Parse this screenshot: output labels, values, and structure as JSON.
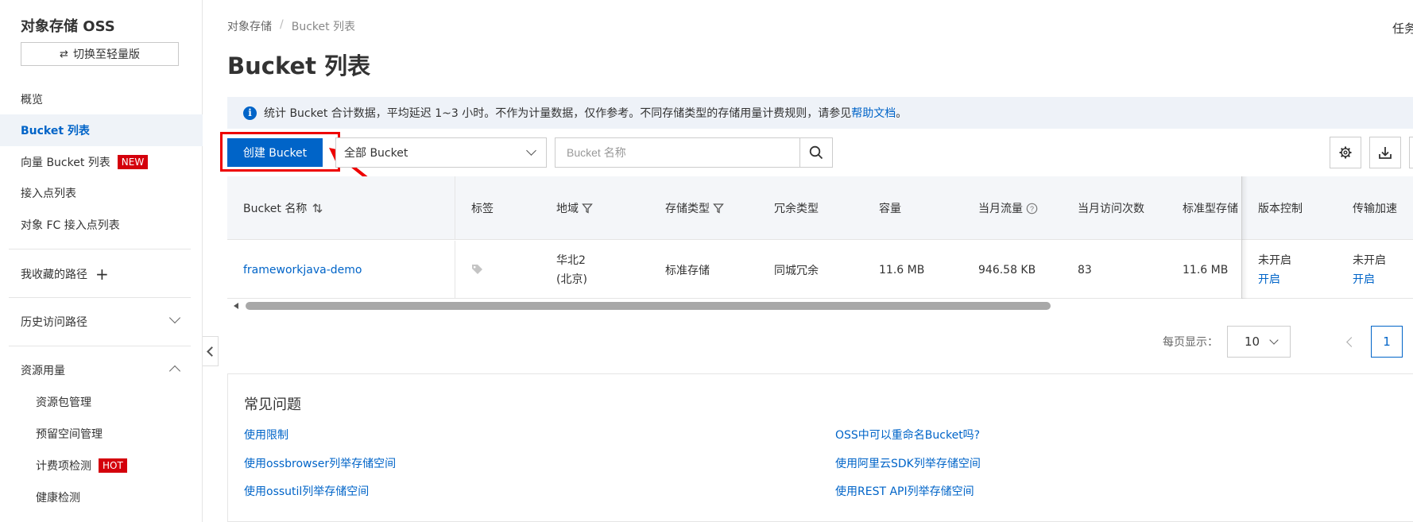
{
  "sidebar": {
    "title": "对象存储 OSS",
    "switch_label": "切换至轻量版",
    "items": [
      {
        "label": "概览"
      },
      {
        "label": "Bucket 列表"
      },
      {
        "label": "向量 Bucket 列表",
        "badge": "NEW"
      },
      {
        "label": "接入点列表"
      },
      {
        "label": "对象 FC 接入点列表"
      },
      {
        "label": "我收藏的路径"
      },
      {
        "label": "历史访问路径"
      },
      {
        "label": "资源用量"
      },
      {
        "label": "资源包管理"
      },
      {
        "label": "预留空间管理"
      },
      {
        "label": "计费项检测",
        "badge": "HOT"
      },
      {
        "label": "健康检测"
      }
    ]
  },
  "breadcrumb": {
    "root": "对象存储",
    "sep": "/",
    "current": "Bucket 列表"
  },
  "page_title": "Bucket 列表",
  "top_right_text": "任务",
  "notice": {
    "text": "统计 Bucket 合计数据，平均延迟 1~3 小时。不作为计量数据，仅作参考。不同存储类型的存储用量计费规则，请参见",
    "link": "帮助文档",
    "end": "。"
  },
  "toolbar": {
    "create_label": "创建 Bucket",
    "filter_value": "全部 Bucket",
    "search_placeholder": "Bucket 名称"
  },
  "table": {
    "headers": [
      "Bucket 名称",
      "标签",
      "地域",
      "存储类型",
      "冗余类型",
      "容量",
      "当月流量",
      "当月访问次数",
      "标准型存储",
      "版本控制",
      "传输加速"
    ],
    "row": {
      "name": "frameworkjava-demo",
      "region_line1": "华北2",
      "region_line2": "(北京)",
      "storage_type": "标准存储",
      "redundancy": "同城冗余",
      "capacity": "11.6 MB",
      "traffic": "946.58 KB",
      "visits": "83",
      "standard_storage": "11.6 MB",
      "versioning_status": "未开启",
      "versioning_action": "开启",
      "accel_status": "未开启",
      "accel_action": "开启"
    }
  },
  "pagination": {
    "label": "每页显示：",
    "page_size": "10",
    "current_page": "1"
  },
  "faq": {
    "title": "常见问题",
    "links": [
      "使用限制",
      "OSS中可以重命名Bucket吗?",
      "使用ossbrowser列举存储空间",
      "使用阿里云SDK列举存储空间",
      "使用ossutil列举存储空间",
      "使用REST API列举存储空间"
    ]
  },
  "colors": {
    "primary": "#0064c8",
    "badge": "#d4000c",
    "annotation": "#e00000"
  }
}
